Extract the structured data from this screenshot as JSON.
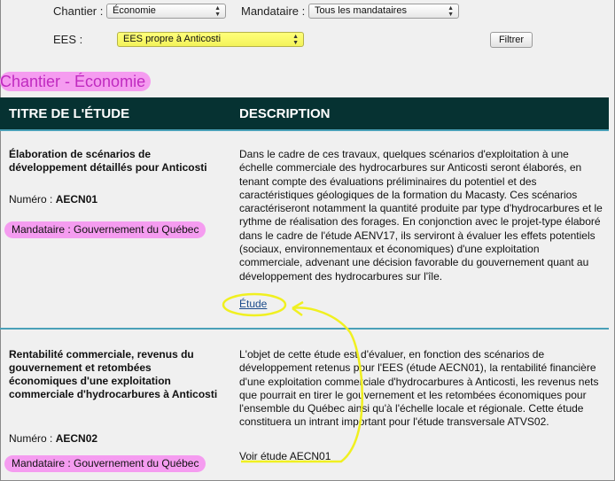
{
  "filters": {
    "chantier_label": "Chantier :",
    "chantier_value": "Économie",
    "mandataire_label": "Mandataire :",
    "mandataire_value": "Tous les mandataires",
    "ees_label": "EES :",
    "ees_value": "EES propre à Anticosti",
    "filter_button": "Filtrer"
  },
  "section_title": "Chantier - Économie",
  "table": {
    "col_title": "TITRE DE L'ÉTUDE",
    "col_desc": "DESCRIPTION"
  },
  "rows": [
    {
      "title": "Élaboration de scénarios de développement détaillés pour Anticosti",
      "num_label": "Numéro :",
      "num_value": "AECN01",
      "mandataire": "Mandataire : Gouvernement du Québec",
      "description": "Dans le cadre de ces travaux, quelques scénarios d'exploitation à une échelle commerciale des hydrocarbures sur Anticosti seront élaborés, en tenant compte des évaluations préliminaires du potentiel et des caractéristiques géologiques de la formation du Macasty. Ces scénarios caractériseront notamment la quantité produite par type d'hydrocarbures et le rythme de réalisation des forages. En conjonction avec le projet-type élaboré dans le cadre de l'étude AENV17, ils serviront à évaluer les effets potentiels (sociaux, environnementaux et économiques) d'une exploitation commerciale, advenant une décision favorable du gouvernement quant au développement des hydrocarbures sur l'île.",
      "link": "Étude"
    },
    {
      "title": "Rentabilité commerciale, revenus du gouvernement et retombées économiques d'une exploitation commerciale d'hydrocarbures à Anticosti",
      "num_label": "Numéro :",
      "num_value": "AECN02",
      "mandataire": "Mandataire : Gouvernement du Québec",
      "description": "L'objet de cette étude est d'évaluer, en fonction des scénarios de développement retenus pour l'EES (étude AECN01), la rentabilité financière d'une exploitation commerciale d'hydrocarbures à Anticosti, les revenus nets que pourrait en tirer le gouvernement et les retombées économiques pour l'ensemble du Québec ainsi qu'à l'échelle locale et régionale. Cette étude constituera un intrant important pour l'étude transversale ATVS02.",
      "link": "Voir étude AECN01"
    }
  ],
  "colors": {
    "header_bg": "#063232",
    "accent_line": "#4aa0b8",
    "highlight_pink": "#f59cf0",
    "annotation_yellow": "#f0f020"
  }
}
